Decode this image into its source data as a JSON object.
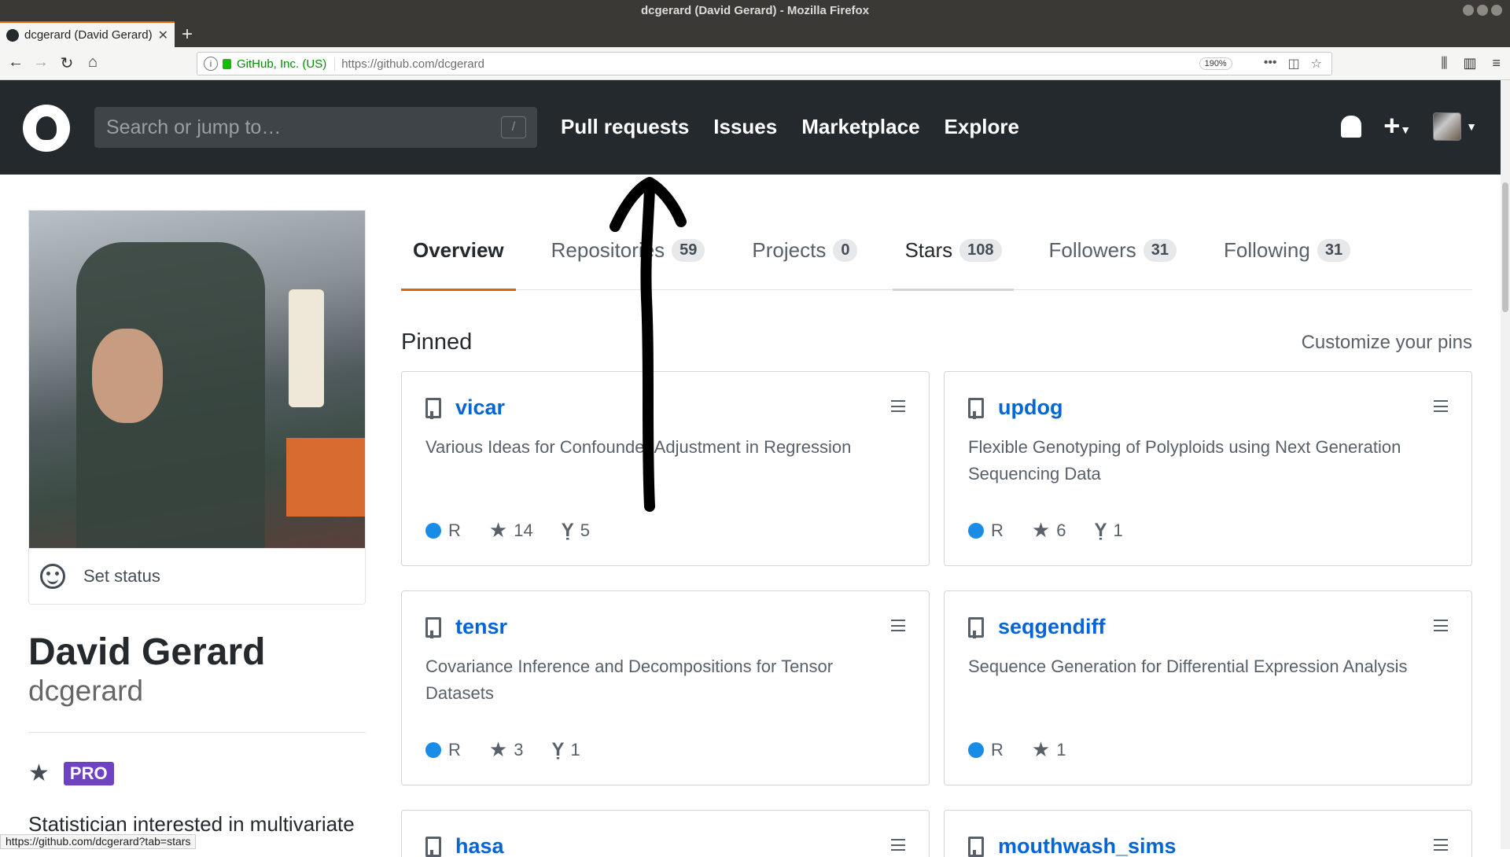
{
  "window": {
    "title": "dcgerard (David Gerard) - Mozilla Firefox"
  },
  "browser": {
    "tab_title": "dcgerard (David Gerard)",
    "identity": "GitHub, Inc. (US)",
    "url": "https://github.com/dcgerard",
    "zoom": "190%",
    "status_url": "https://github.com/dcgerard?tab=stars"
  },
  "github": {
    "search_placeholder": "Search or jump to…",
    "search_key": "/",
    "nav": [
      "Pull requests",
      "Issues",
      "Marketplace",
      "Explore"
    ]
  },
  "profile": {
    "set_status": "Set status",
    "fullname": "David Gerard",
    "username": "dcgerard",
    "badge": "PRO",
    "bio": "Statistician interested in multivariate"
  },
  "tabs": [
    {
      "label": "Overview",
      "count": null
    },
    {
      "label": "Repositories",
      "count": "59"
    },
    {
      "label": "Projects",
      "count": "0"
    },
    {
      "label": "Stars",
      "count": "108"
    },
    {
      "label": "Followers",
      "count": "31"
    },
    {
      "label": "Following",
      "count": "31"
    }
  ],
  "pinned": {
    "title": "Pinned",
    "customize": "Customize your pins",
    "repos": [
      {
        "name": "vicar",
        "description": "Various Ideas for Confounder Adjustment in Regression",
        "language": "R",
        "stars": "14",
        "forks": "5"
      },
      {
        "name": "updog",
        "description": "Flexible Genotyping of Polyploids using Next Generation Sequencing Data",
        "language": "R",
        "stars": "6",
        "forks": "1"
      },
      {
        "name": "tensr",
        "description": "Covariance Inference and Decompositions for Tensor Datasets",
        "language": "R",
        "stars": "3",
        "forks": "1"
      },
      {
        "name": "seqgendiff",
        "description": "Sequence Generation for Differential Expression Analysis",
        "language": "R",
        "stars": "1",
        "forks": null
      },
      {
        "name": "hasa",
        "description": "",
        "language": "",
        "stars": "",
        "forks": null
      },
      {
        "name": "mouthwash_sims",
        "description": "",
        "language": "",
        "stars": "",
        "forks": null
      }
    ]
  },
  "colors": {
    "accent": "#e36209",
    "link": "#0366d6",
    "header": "#24292e",
    "r_language": "#198ce7",
    "pro": "#6f42c1"
  }
}
